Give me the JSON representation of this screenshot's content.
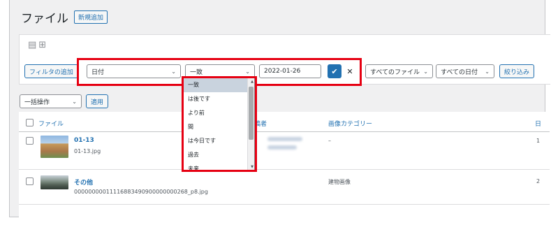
{
  "header": {
    "title": "ファイル",
    "add_new": "新規追加"
  },
  "view_icons": {
    "list": "list-view-icon",
    "grid": "grid-view-icon"
  },
  "filter": {
    "add_filter": "フィルタの追加",
    "field_select": "日付",
    "operator_select": "一致",
    "date_value": "2022-01-26",
    "confirm": "✔",
    "remove": "✕",
    "all_files": "すべてのファイル",
    "all_dates": "すべての日付",
    "narrow": "絞り込み"
  },
  "bulk": {
    "select": "一括操作",
    "apply": "適用"
  },
  "operator_options": [
    "一致",
    "は後です",
    "より前",
    "間",
    "は今日です",
    "過去",
    "未来"
  ],
  "table": {
    "col_file": "ファイル",
    "col_author": "稿者",
    "col_category": "画像カテゴリー",
    "col_date_partial": "日",
    "rows": [
      {
        "title": "01-13",
        "filename": "01-13.jpg",
        "category": "–",
        "date_partial": "1"
      },
      {
        "title": "その他",
        "filename": "00000000011116883490900000000268_p8.jpg",
        "category": "建物画像",
        "date_partial": "2"
      }
    ]
  },
  "colors": {
    "accent": "#2271b1",
    "highlight_border": "#e60012"
  }
}
